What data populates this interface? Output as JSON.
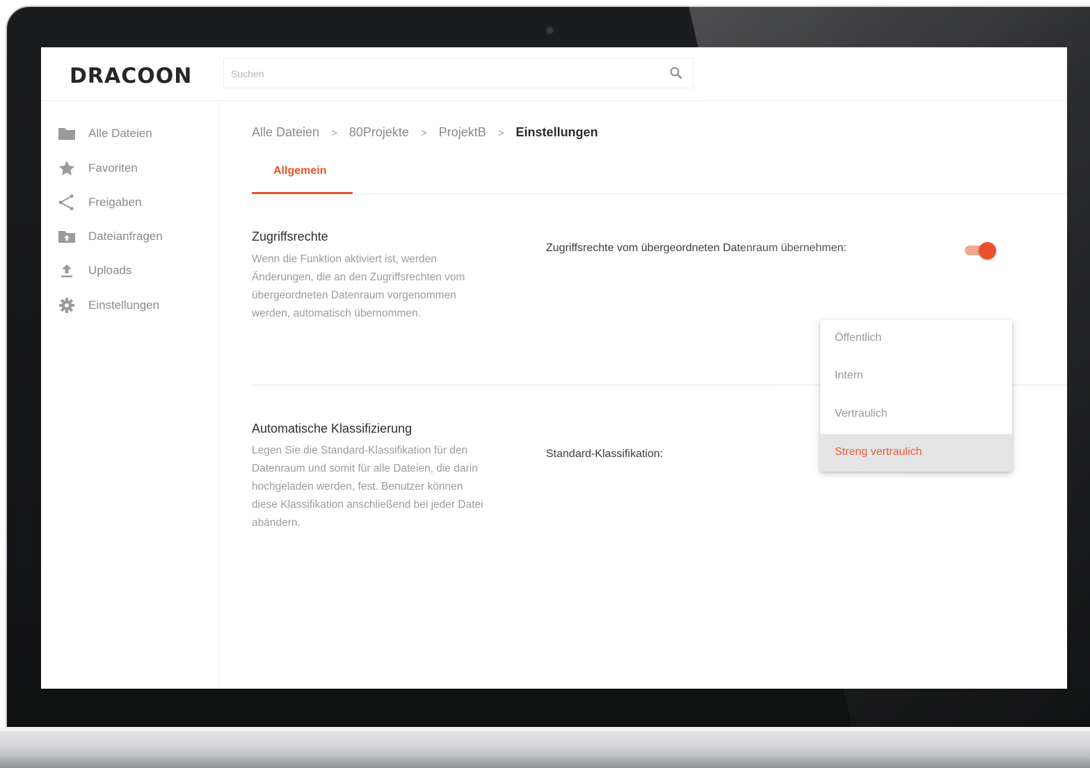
{
  "app": {
    "logo_text": "DRACOON"
  },
  "search": {
    "placeholder": "Suchen"
  },
  "sidebar": {
    "items": [
      {
        "label": "Alle Dateien",
        "icon": "folder-icon"
      },
      {
        "label": "Favoriten",
        "icon": "star-icon"
      },
      {
        "label": "Freigaben",
        "icon": "share-icon"
      },
      {
        "label": "Dateianfragen",
        "icon": "folder-upload-icon"
      },
      {
        "label": "Uploads",
        "icon": "upload-icon"
      },
      {
        "label": "Einstellungen",
        "icon": "gear-icon"
      }
    ]
  },
  "breadcrumb": {
    "items": [
      "Alle Dateien",
      "80Projekte",
      "ProjektB",
      "Einstellungen"
    ],
    "separator": ">"
  },
  "tabs": {
    "active": "Allgemein"
  },
  "access_rights": {
    "title": "Zugriffsrechte",
    "description": "Wenn die Funktion aktiviert ist, werden Änderungen, die an den Zugriffsrechten vom übergeordneten Datenraum vorgenommen werden, automatisch übernommen.",
    "setting_label": "Zugriffsrechte vom übergeordneten Datenraum übernehmen:",
    "toggle_on": true
  },
  "classification": {
    "title": "Automatische Klassifizierung",
    "description": "Legen Sie die Standard-Klassifikation für den Datenraum und somit für alle Dateien, die darin hochgeladen werden, fest. Benutzer können diese Klassifikation anschließend bei jeder Datei abändern.",
    "setting_label": "Standard-Klassifikation:",
    "options": [
      "Öffentlich",
      "Intern",
      "Vertraulich",
      "Streng vertraulich"
    ],
    "selected": "Streng vertraulich"
  },
  "colors": {
    "accent": "#e8542c",
    "toggle_thumb": "#e8431c",
    "toggle_track": "#f1a28c",
    "muted_text": "#8a8a8a"
  }
}
